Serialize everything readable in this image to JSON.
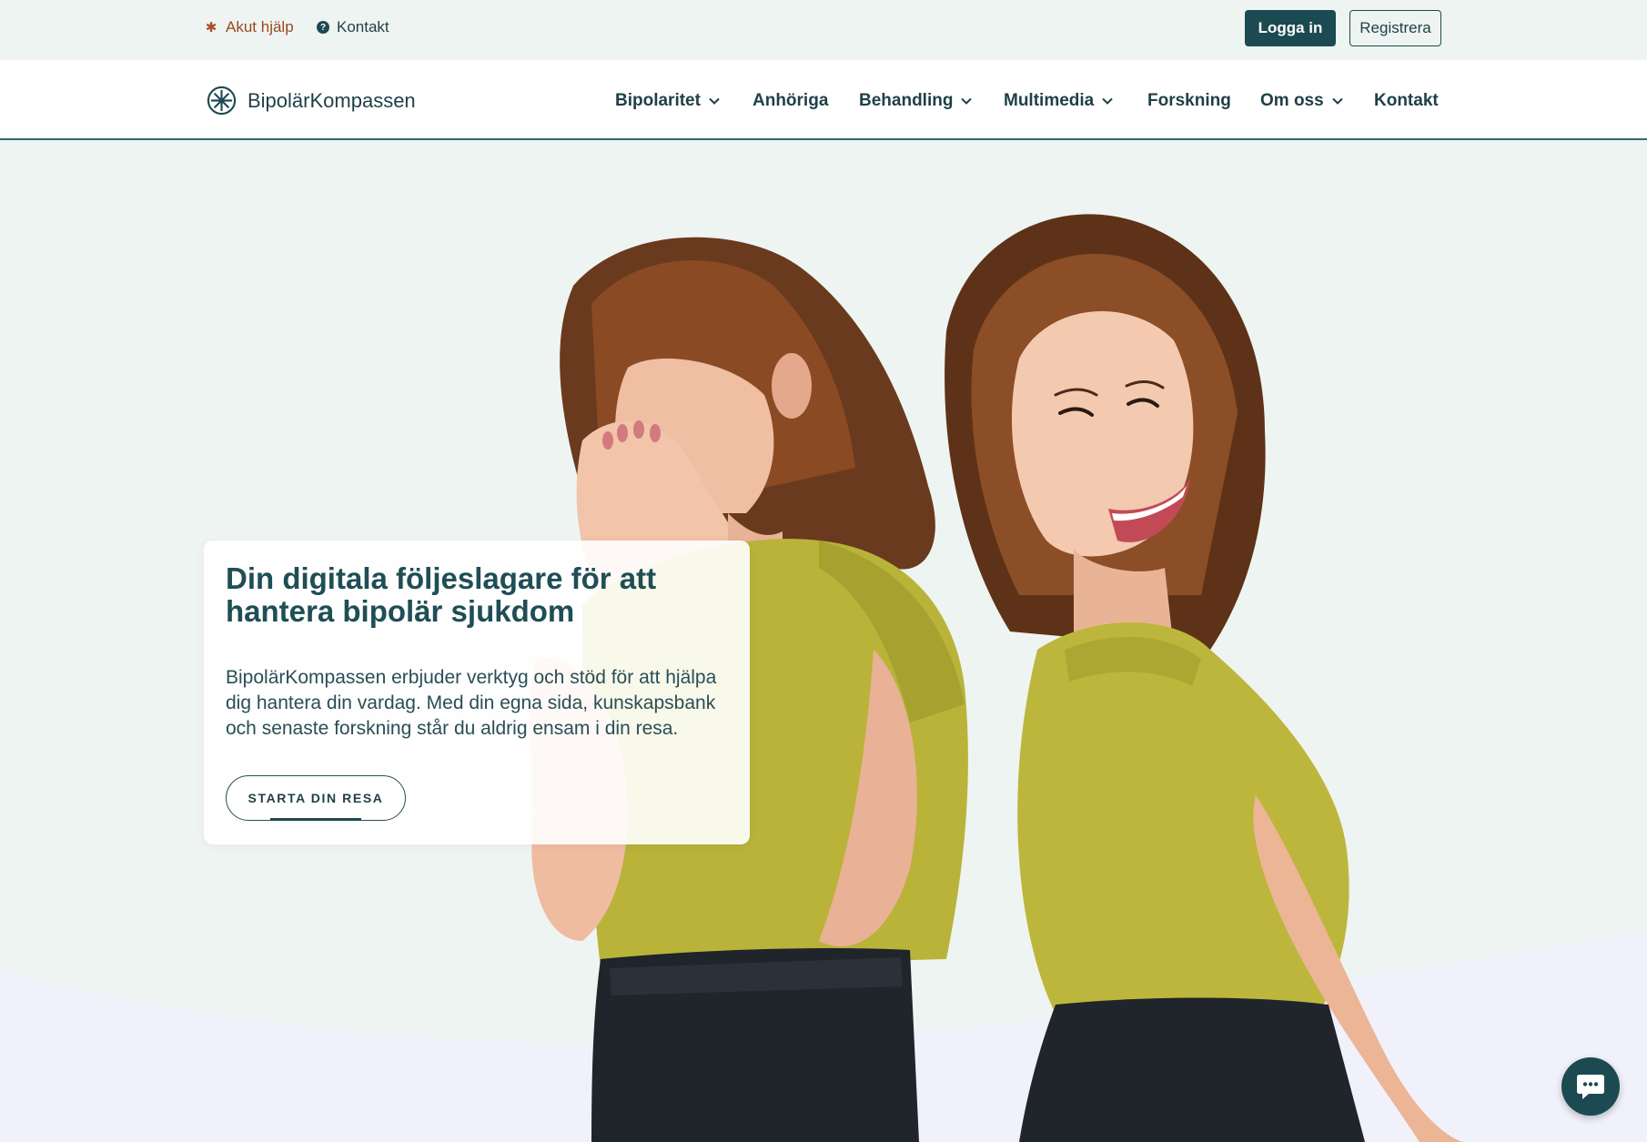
{
  "topbar": {
    "akut_label": "Akut hjälp",
    "akut_icon": "asterisk-icon",
    "kontakt_label": "Kontakt",
    "kontakt_icon": "question-circle-icon",
    "login_label": "Logga in",
    "register_label": "Registrera"
  },
  "brand": {
    "name": "BipolärKompassen",
    "logo_icon": "compass-icon"
  },
  "nav": {
    "items": [
      {
        "label": "Bipolaritet",
        "dropdown": true
      },
      {
        "label": "Anhöriga",
        "dropdown": false
      },
      {
        "label": "Behandling",
        "dropdown": true
      },
      {
        "label": "Multimedia",
        "dropdown": true
      },
      {
        "label": "Forskning",
        "dropdown": false
      },
      {
        "label": "Om oss",
        "dropdown": true
      },
      {
        "label": "Kontakt",
        "dropdown": false
      }
    ]
  },
  "hero": {
    "title": "Din digitala följeslagare för att hantera bipolär sjukdom",
    "description": "BipolärKompassen erbjuder verktyg och stöd för att hjälpa dig hantera din vardag. Med din egna sida, kunskapsbank och senaste forskning står du aldrig ensam i din resa.",
    "cta_label": "STARTA DIN RESA"
  },
  "chat": {
    "icon": "chat-bubble-icon"
  },
  "colors": {
    "primary": "#1c4a52",
    "text": "#1f3f47",
    "accent_warm": "#9a4a1e",
    "background": "#eef4f1",
    "shirt": "#b9b33a"
  }
}
